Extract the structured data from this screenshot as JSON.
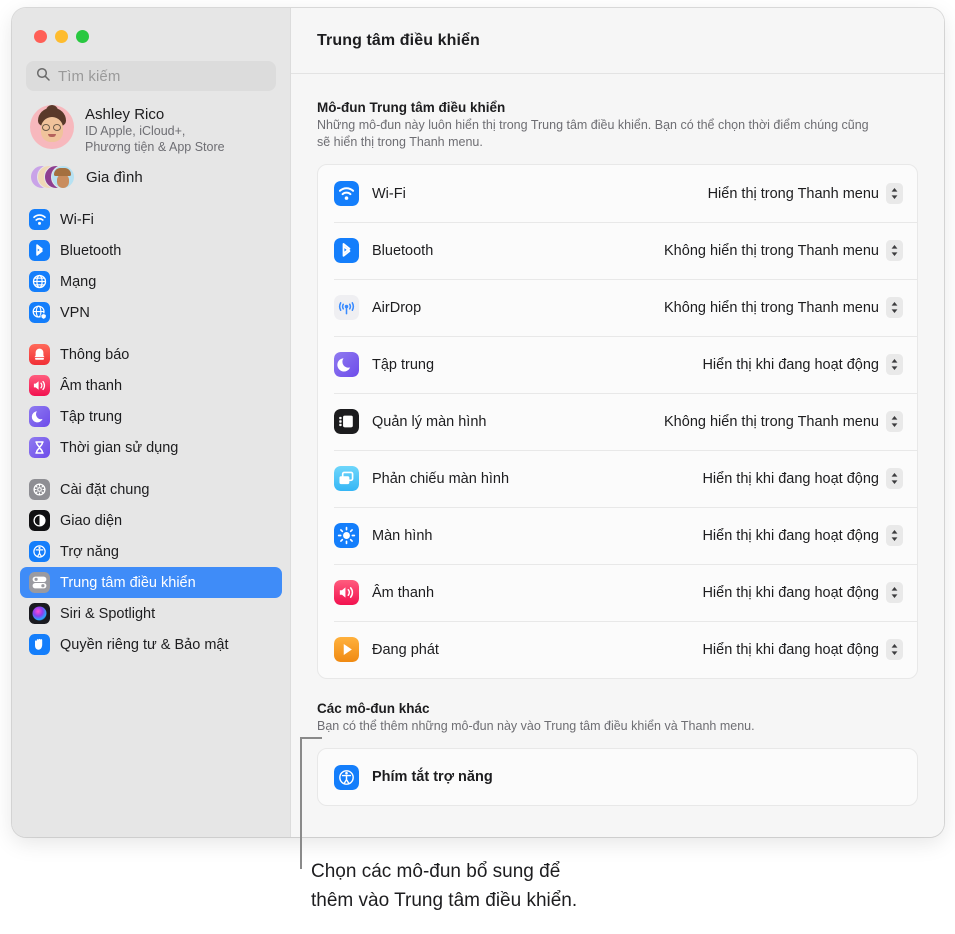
{
  "window": {
    "traffic_lights": [
      "close",
      "minimize",
      "zoom"
    ],
    "colors": {
      "close": "#ff5f57",
      "minimize": "#febc2e",
      "zoom": "#28c840",
      "accent": "#3f8cf8"
    }
  },
  "sidebar": {
    "search": {
      "placeholder": "Tìm kiếm",
      "icon": "search-icon"
    },
    "account": {
      "name": "Ashley Rico",
      "subtitle_line1": "ID Apple, iCloud+,",
      "subtitle_line2": "Phương tiện & App Store"
    },
    "family": {
      "label": "Gia đình"
    },
    "groups": [
      {
        "items": [
          {
            "label": "Wi-Fi",
            "icon": "wifi-icon",
            "selected": false
          },
          {
            "label": "Bluetooth",
            "icon": "bluetooth-icon",
            "selected": false
          },
          {
            "label": "Mạng",
            "icon": "network-globe-icon",
            "selected": false
          },
          {
            "label": "VPN",
            "icon": "vpn-globe-icon",
            "selected": false
          }
        ]
      },
      {
        "items": [
          {
            "label": "Thông báo",
            "icon": "notifications-bell-icon",
            "selected": false
          },
          {
            "label": "Âm thanh",
            "icon": "sound-speaker-icon",
            "selected": false
          },
          {
            "label": "Tập trung",
            "icon": "focus-moon-icon",
            "selected": false
          },
          {
            "label": "Thời gian sử dụng",
            "icon": "screen-time-hourglass-icon",
            "selected": false
          }
        ]
      },
      {
        "items": [
          {
            "label": "Cài đặt chung",
            "icon": "general-gear-icon",
            "selected": false
          },
          {
            "label": "Giao diện",
            "icon": "appearance-icon",
            "selected": false
          },
          {
            "label": "Trợ năng",
            "icon": "accessibility-icon",
            "selected": false
          },
          {
            "label": "Trung tâm điều khiển",
            "icon": "control-center-icon",
            "selected": true
          },
          {
            "label": "Siri & Spotlight",
            "icon": "siri-icon",
            "selected": false
          },
          {
            "label": "Quyền riêng tư & Bảo mật",
            "icon": "privacy-hand-icon",
            "selected": false
          }
        ]
      }
    ]
  },
  "header": {
    "title": "Trung tâm điều khiển"
  },
  "main": {
    "section1": {
      "title": "Mô-đun Trung tâm điều khiển",
      "description": "Những mô-đun này luôn hiển thị trong Trung tâm điều khiển. Bạn có thể chọn thời điểm chúng cũng sẽ hiển thị trong Thanh menu.",
      "rows": [
        {
          "label": "Wi-Fi",
          "icon": "wifi-icon",
          "value": "Hiển thị trong Thanh menu"
        },
        {
          "label": "Bluetooth",
          "icon": "bluetooth-icon",
          "value": "Không hiển thị trong Thanh menu"
        },
        {
          "label": "AirDrop",
          "icon": "airdrop-icon",
          "value": "Không hiển thị trong Thanh menu"
        },
        {
          "label": "Tập trung",
          "icon": "focus-moon-icon",
          "value": "Hiển thị khi đang hoạt động"
        },
        {
          "label": "Quản lý màn hình",
          "icon": "stage-manager-icon",
          "value": "Không hiển thị trong Thanh menu"
        },
        {
          "label": "Phản chiếu màn hình",
          "icon": "screen-mirroring-icon",
          "value": "Hiển thị khi đang hoạt động"
        },
        {
          "label": "Màn hình",
          "icon": "display-brightness-icon",
          "value": "Hiển thị khi đang hoạt động"
        },
        {
          "label": "Âm thanh",
          "icon": "sound-speaker-icon",
          "value": "Hiển thị khi đang hoạt động"
        },
        {
          "label": "Đang phát",
          "icon": "now-playing-icon",
          "value": "Hiển thị khi đang hoạt động"
        }
      ]
    },
    "section2": {
      "title": "Các mô-đun khác",
      "description": "Bạn có thể thêm những mô-đun này vào Trung tâm điều khiển và Thanh menu.",
      "rows": [
        {
          "label": "Phím tắt trợ năng",
          "icon": "accessibility-icon"
        }
      ]
    }
  },
  "callout": {
    "text": "Chọn các mô-đun bổ sung để\nthêm vào Trung tâm điều khiển."
  }
}
